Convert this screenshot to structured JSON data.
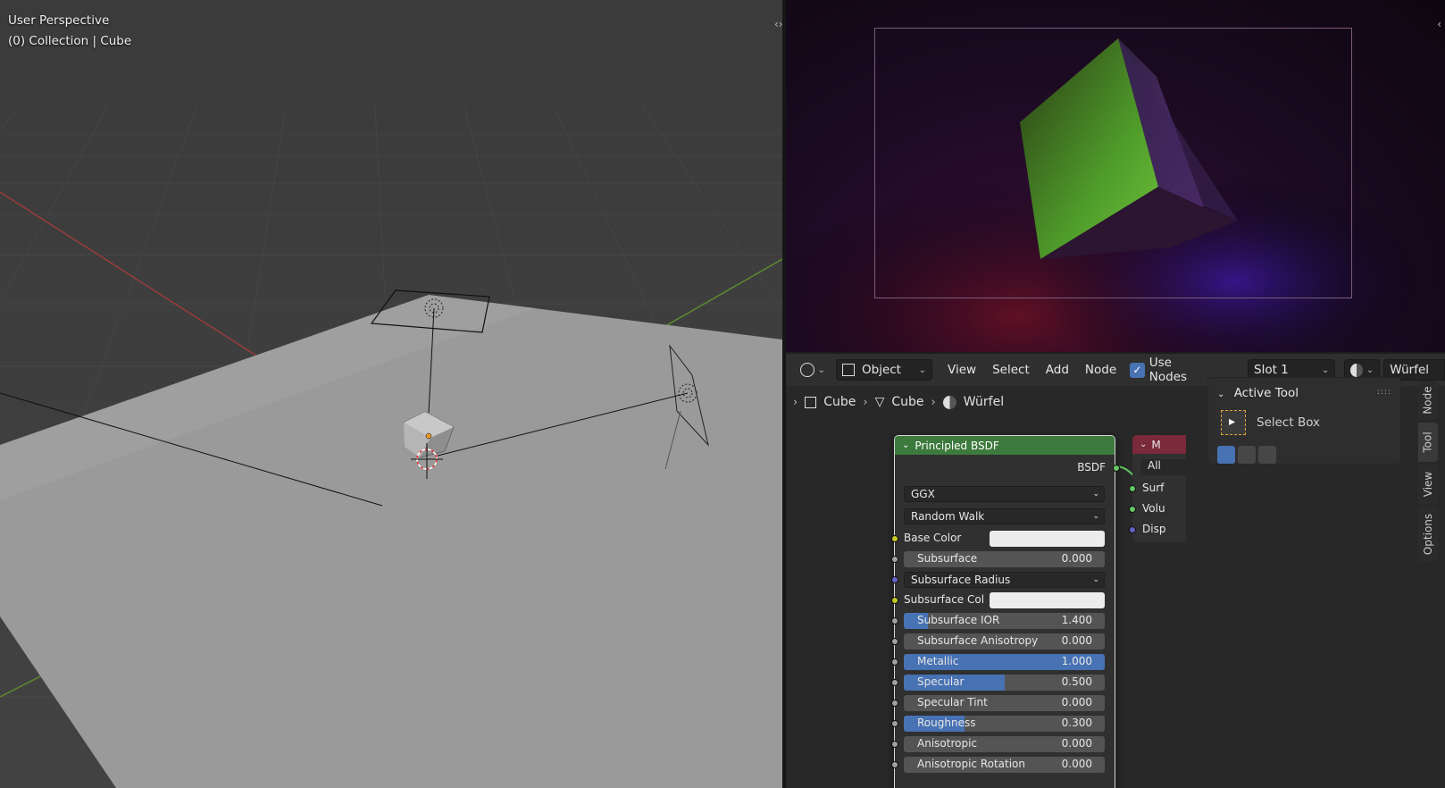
{
  "viewport": {
    "perspective_label": "User Perspective",
    "collection_label": "(0) Collection | Cube"
  },
  "node_editor": {
    "header": {
      "editor_type_icon": "node-editor-icon",
      "mode": "Object",
      "menus": [
        "View",
        "Select",
        "Add",
        "Node"
      ],
      "use_nodes_label": "Use Nodes",
      "use_nodes_checked": true,
      "slot": "Slot 1",
      "material_name": "Würfel"
    },
    "breadcrumb": [
      {
        "icon": "object-icon",
        "label": "Cube"
      },
      {
        "icon": "mesh-icon",
        "label": "Cube"
      },
      {
        "icon": "material-icon",
        "label": "Würfel"
      }
    ],
    "principled": {
      "title": "Principled BSDF",
      "output": "BSDF",
      "distribution": "GGX",
      "subsurface_method": "Random Walk",
      "base_color_label": "Base Color",
      "subsurface_radius_label": "Subsurface Radius",
      "subsurface_col_label": "Subsurface Col",
      "sliders": [
        {
          "label": "Subsurface",
          "value": "0.000",
          "fill": 0.0
        },
        {
          "label": "Subsurface IOR",
          "value": "1.400",
          "fill": 0.12
        },
        {
          "label": "Subsurface Anisotropy",
          "value": "0.000",
          "fill": 0.0
        },
        {
          "label": "Metallic",
          "value": "1.000",
          "fill": 1.0
        },
        {
          "label": "Specular",
          "value": "0.500",
          "fill": 0.5
        },
        {
          "label": "Specular Tint",
          "value": "0.000",
          "fill": 0.0
        },
        {
          "label": "Roughness",
          "value": "0.300",
          "fill": 0.3
        },
        {
          "label": "Anisotropic",
          "value": "0.000",
          "fill": 0.0
        },
        {
          "label": "Anisotropic Rotation",
          "value": "0.000",
          "fill": 0.0
        }
      ]
    },
    "material_output": {
      "title_partial": "M",
      "target_partial": "All",
      "inputs": [
        "Surf",
        "Volu",
        "Disp"
      ]
    },
    "sidebar": {
      "panel_title": "Active Tool",
      "tool_name": "Select Box",
      "tabs": [
        "Node",
        "Tool",
        "View",
        "Options"
      ],
      "active_tab": "Tool"
    }
  },
  "colors": {
    "accent": "#4772b3",
    "node_header_shader": "#3d7a3d",
    "node_header_output": "#7a2a3a"
  }
}
